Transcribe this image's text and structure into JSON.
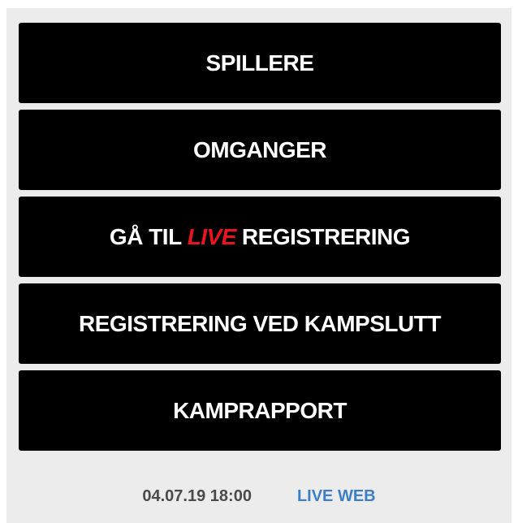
{
  "menu": {
    "spillere_label": "SPILLERE",
    "omganger_label": "OMGANGER",
    "live_registration": {
      "prefix": "GÅ TIL",
      "live_word": "LIVE",
      "suffix": "REGISTRERING"
    },
    "end_registration_label": "REGISTRERING VED KAMPSLUTT",
    "match_report_label": "KAMPRAPPORT"
  },
  "footer": {
    "timestamp": "04.07.19 18:00",
    "live_web_label": "LIVE WEB"
  },
  "colors": {
    "button_bg": "#000000",
    "button_text": "#ffffff",
    "live_accent": "#e8141e",
    "link": "#3d7fc6",
    "panel_bg": "#ececec"
  }
}
